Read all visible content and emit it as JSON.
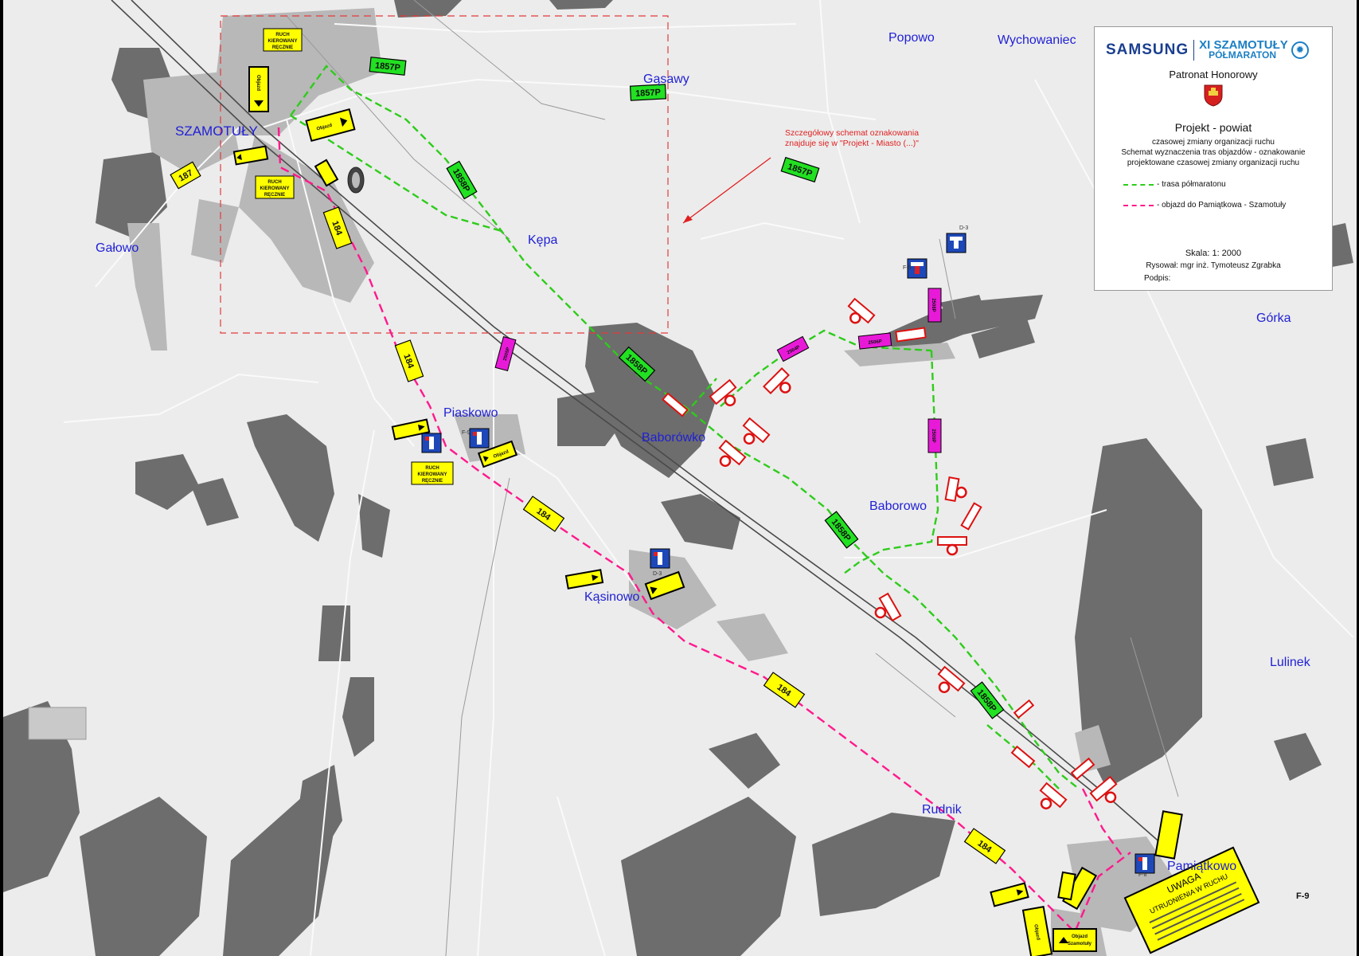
{
  "places": {
    "szamotuly": "SZAMOTUŁY",
    "popowo": "Popowo",
    "wychowaniec": "Wychowaniec",
    "gasawy": "Gąsawy",
    "galowo": "Gałowo",
    "kepa": "Kępa",
    "piaskowo": "Piaskowo",
    "baborowko": "Baborówko",
    "baborowo": "Baborowo",
    "gorka": "Górka",
    "kasinowo": "Kąsinowo",
    "lulinek": "Lulinek",
    "rudnik": "Rudnik",
    "pamiatkowo": "Pamiątkowo"
  },
  "road_tags": {
    "r187": "187",
    "r184": "184",
    "r1857p": "1857P",
    "r1858p": "1858P",
    "r2505p": "2505P",
    "r2504p": "2504P",
    "r2506p": "2506P",
    "r2508p": "2508P",
    "r2509p": "2509P"
  },
  "signs": {
    "manual_traffic": "RUCH KIEROWANY RĘCZNIE",
    "objazd": "Objazd",
    "objazd_szamotuly": "Objazd Szamotuły",
    "f9": "F-9",
    "d3": "D-3",
    "f8": "F-8",
    "warning_title": "UWAGA",
    "warning_sub": "UTRUDNIENIA W RUCHU"
  },
  "annotation": {
    "line1": "Szczegółowy schemat oznakowania",
    "line2": "znajduje się w \"Projekt - Miasto (...)\""
  },
  "legend": {
    "sponsor": "SAMSUNG",
    "event_line1": "XI SZAMOTUŁY",
    "event_line2": "PÓŁMARATON",
    "honor": "Patronat Honorowy",
    "project_title": "Projekt - powiat",
    "desc1": "czasowej zmiany organizacji ruchu",
    "desc2": "Schemat wyznaczenia tras objazdów - oznakowanie",
    "desc3": "projektowane czasowej zmiany organizacji ruchu",
    "item_route": "- trasa półmaratonu",
    "item_detour": "- objazd do Pamiątkowa - Szamotuły",
    "scale": "Skala: 1: 2000",
    "drawn_by": "Rysował: mgr inż. Tymoteusz Zgrabka",
    "signature": "Podpis:"
  },
  "colors": {
    "route": "#2ecc1b",
    "detour": "#ff1a8c",
    "road_tag_yellow": "#ffff00",
    "road_tag_green": "#22e022",
    "road_tag_magenta": "#e81ad8",
    "place_text": "#1f1fd6",
    "annotation": "#e02020"
  }
}
